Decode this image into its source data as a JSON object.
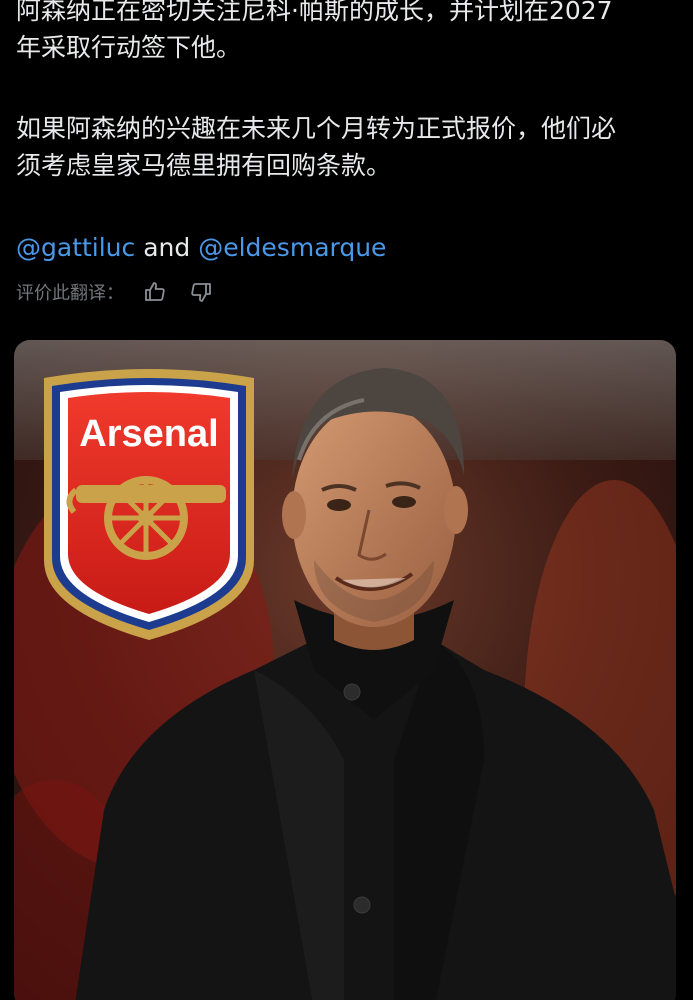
{
  "tweet": {
    "paragraph1": "阿森纳正在密切关注尼科·帕斯的成长，并计划在2027\n年采取行动签下他。",
    "paragraph2": "如果阿森纳的兴趣在未来几个月转为正式报价，他们必\n须考虑皇家马德里拥有回购条款。",
    "mention1": "@gattiluc",
    "and_word": "and",
    "mention2": "@eldesmarque"
  },
  "translation": {
    "rate_label": "评价此翻译：",
    "thumbs_up_icon": "thumbs-up-icon",
    "thumbs_down_icon": "thumbs-down-icon"
  },
  "media": {
    "logo_text": "Arsenal",
    "colors": {
      "background": "#000000",
      "text": "#e7e9ea",
      "mention": "#4a99e9",
      "muted": "#71767b",
      "crest_red": "#e4261c",
      "crest_gold": "#c9a24a",
      "crest_blue": "#1d3c8f"
    }
  }
}
